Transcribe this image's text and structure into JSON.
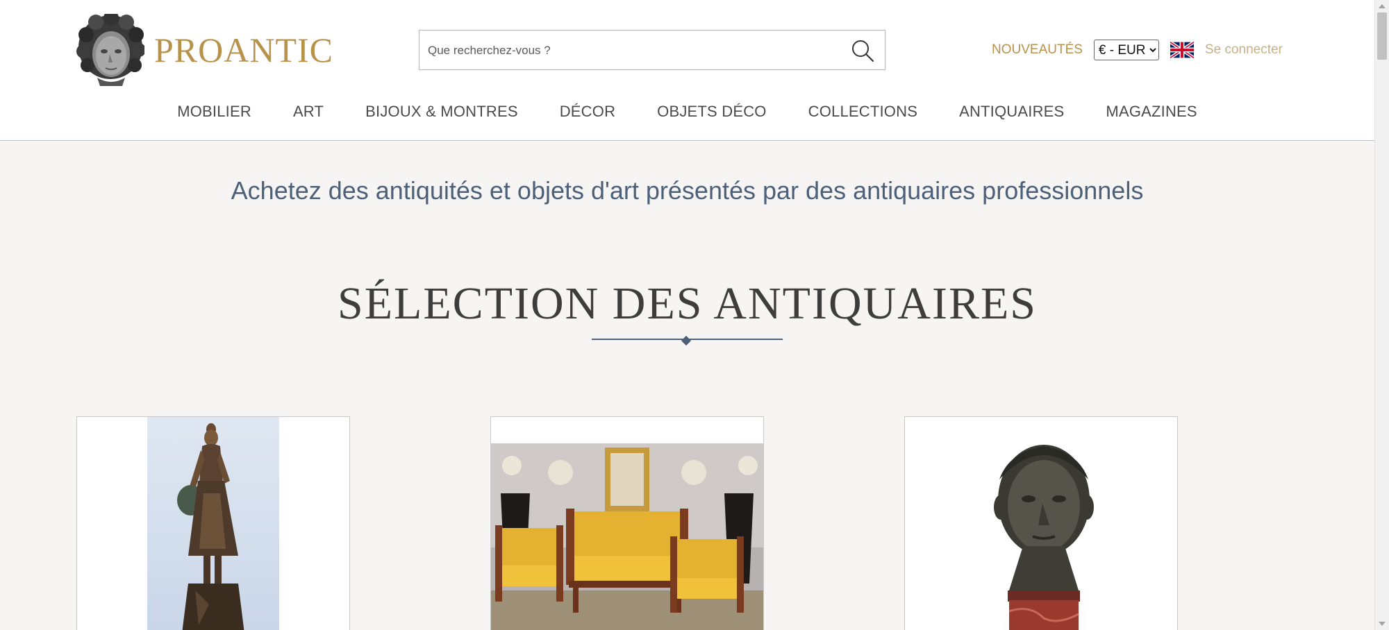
{
  "brand": {
    "name": "PROANTIC",
    "logo_icon": "cherub-head-icon",
    "color": "#b8914a"
  },
  "search": {
    "placeholder": "Que recherchez-vous ?",
    "value": "",
    "icon": "search-icon"
  },
  "header_right": {
    "new_label": "NOUVEAUTÉS",
    "currency_selected": "€ - EUR",
    "language_icon": "uk-flag-icon",
    "login_label": "Se connecter"
  },
  "nav": {
    "items": [
      {
        "label": "MOBILIER"
      },
      {
        "label": "ART"
      },
      {
        "label": "BIJOUX & MONTRES"
      },
      {
        "label": "DÉCOR"
      },
      {
        "label": "OBJETS DÉCO"
      },
      {
        "label": "COLLECTIONS"
      },
      {
        "label": "ANTIQUAIRES"
      },
      {
        "label": "MAGAZINES"
      }
    ]
  },
  "hero": {
    "tagline": "Achetez des antiquités et objets d'art présentés par des antiquaires professionnels"
  },
  "selection": {
    "title": "SÉLECTION DES ANTIQUAIRES",
    "cards": [
      {
        "image": "bronze-water-carrier-statue"
      },
      {
        "image": "empire-yellow-sofa-set"
      },
      {
        "image": "bronze-head-bust-on-marble"
      }
    ]
  },
  "colors": {
    "accent_gold": "#b8914a",
    "text_blue": "#4d6079",
    "background": "#f6f5f3"
  }
}
